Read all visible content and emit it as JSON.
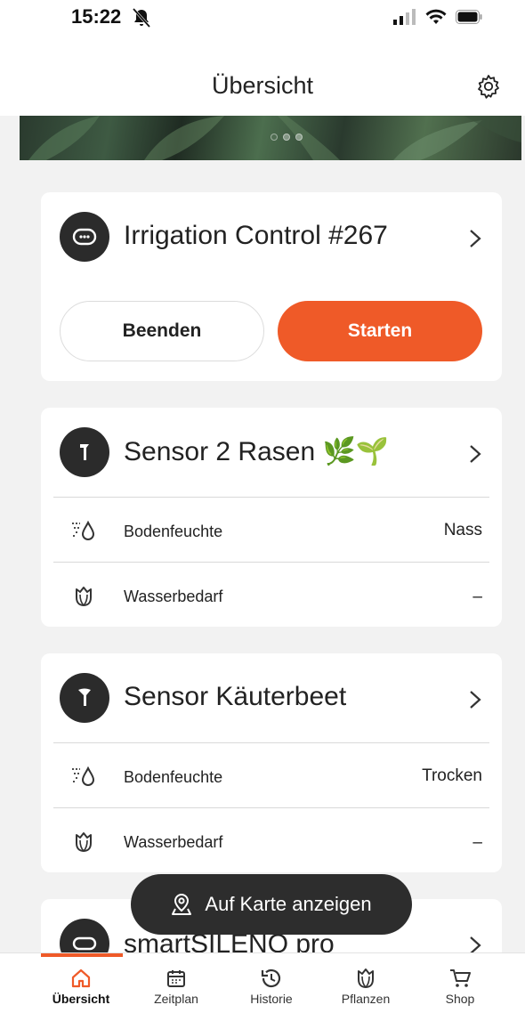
{
  "status_bar": {
    "time": "15:22"
  },
  "header": {
    "title": "Übersicht"
  },
  "colors": {
    "accent": "#ef5a28",
    "dark": "#2b2b2b",
    "background": "#f2f2f2"
  },
  "cards": {
    "controller": {
      "title": "Irrigation Control #267",
      "icon": "controller-icon",
      "stop_label": "Beenden",
      "start_label": "Starten"
    },
    "sensor1": {
      "title": "Sensor 2 Rasen 🌿🌱",
      "icon": "sensor-icon",
      "rows": [
        {
          "label": "Bodenfeuchte",
          "value": "Nass",
          "icon": "soil-moisture-icon"
        },
        {
          "label": "Wasserbedarf",
          "value": "–",
          "icon": "plant-icon"
        }
      ]
    },
    "sensor2": {
      "title": "Sensor Käuterbeet",
      "icon": "sensor-icon",
      "rows": [
        {
          "label": "Bodenfeuchte",
          "value": "Trocken",
          "icon": "soil-moisture-icon"
        },
        {
          "label": "Wasserbedarf",
          "value": "–",
          "icon": "plant-icon"
        }
      ]
    },
    "mower": {
      "title": "smartSILENO pro",
      "icon": "mower-icon"
    }
  },
  "map_button": {
    "label": "Auf Karte anzeigen",
    "icon": "map-pin-icon"
  },
  "tabbar": {
    "active": "Übersicht",
    "items": [
      {
        "label": "Übersicht",
        "icon": "home-icon"
      },
      {
        "label": "Zeitplan",
        "icon": "calendar-icon"
      },
      {
        "label": "Historie",
        "icon": "history-icon"
      },
      {
        "label": "Pflanzen",
        "icon": "plant-icon"
      },
      {
        "label": "Shop",
        "icon": "cart-icon"
      }
    ]
  }
}
